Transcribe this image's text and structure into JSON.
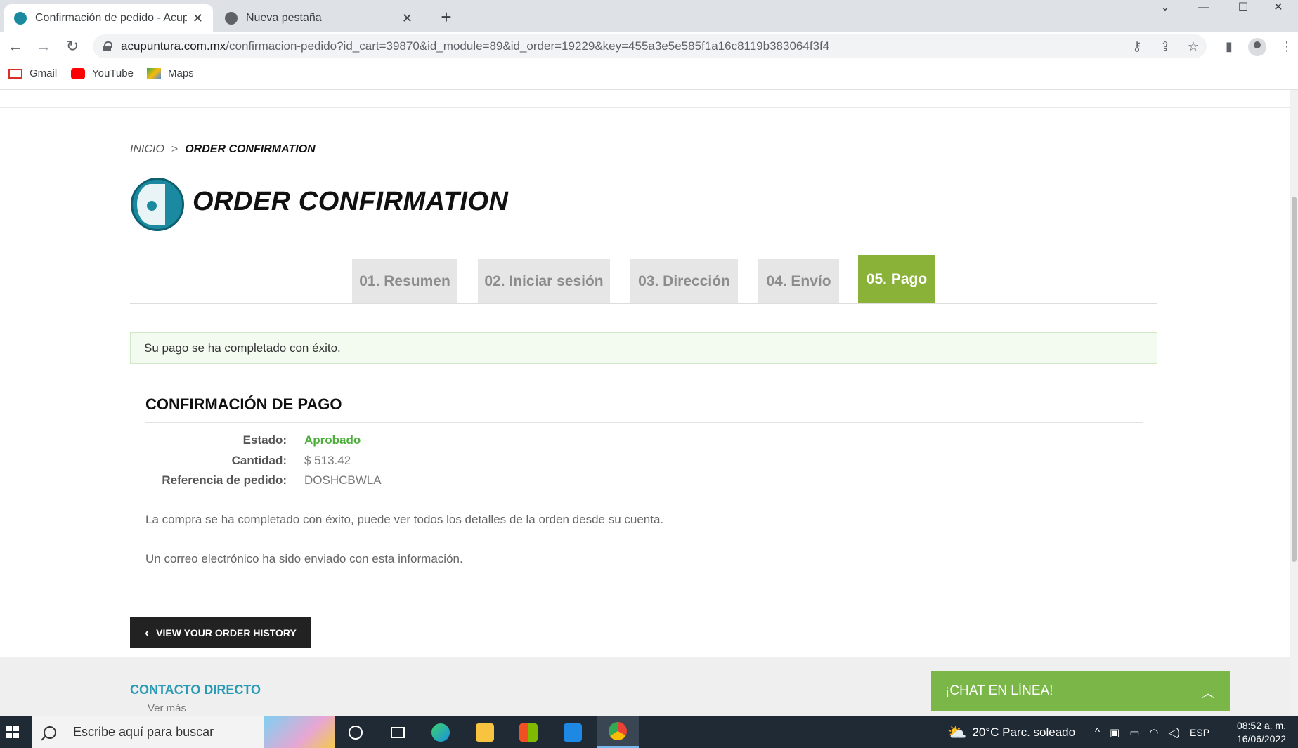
{
  "browser": {
    "tabs": [
      {
        "title": "Confirmación de pedido - Acupuntura.com.mx",
        "active": true
      },
      {
        "title": "Nueva pestaña",
        "active": false
      }
    ],
    "url_host": "acupuntura.com.mx",
    "url_path": "/confirmacion-pedido?id_cart=39870&id_module=89&id_order=19229&key=455a3e5e585f1a16c8119b383064f3f4",
    "bookmarks": [
      {
        "label": "Gmail"
      },
      {
        "label": "YouTube"
      },
      {
        "label": "Maps"
      }
    ]
  },
  "breadcrumb": {
    "home": "INICIO",
    "separator": ">",
    "current": "ORDER CONFIRMATION"
  },
  "page_title": "ORDER CONFIRMATION",
  "steps": [
    {
      "label": "01. Resumen",
      "active": false
    },
    {
      "label": "02. Iniciar sesión",
      "active": false
    },
    {
      "label": "03. Dirección",
      "active": false
    },
    {
      "label": "04. Envío",
      "active": false
    },
    {
      "label": "05. Pago",
      "active": true
    }
  ],
  "alert": "Su pago se ha completado con éxito.",
  "confirmation": {
    "title": "CONFIRMACIÓN DE PAGO",
    "rows": [
      {
        "key": "Estado:",
        "value": "Aprobado"
      },
      {
        "key": "Cantidad:",
        "value": "$ 513.42"
      },
      {
        "key": "Referencia de pedido:",
        "value": "DOSHCBWLA"
      }
    ],
    "message1": "La compra se ha completado con éxito, puede ver todos los detalles de la orden desde su cuenta.",
    "message2": "Un correo electrónico ha sido enviado con esta información."
  },
  "history_button": "VIEW YOUR ORDER HISTORY",
  "footer": {
    "title": "CONTACTO DIRECTO",
    "more": "Ver más"
  },
  "chat": {
    "label": "¡CHAT EN LÍNEA!"
  },
  "taskbar": {
    "search_placeholder": "Escribe aquí para buscar",
    "weather": "20°C  Parc. soleado",
    "language": "ESP",
    "time": "08:52 a. m.",
    "date": "16/06/2022"
  },
  "colors": {
    "step_active": "#8ab238",
    "step_inactive": "#e6e6e6",
    "status_ok": "#4caf3a",
    "footer_link": "#2a9bb5",
    "chat": "#7ab648"
  }
}
